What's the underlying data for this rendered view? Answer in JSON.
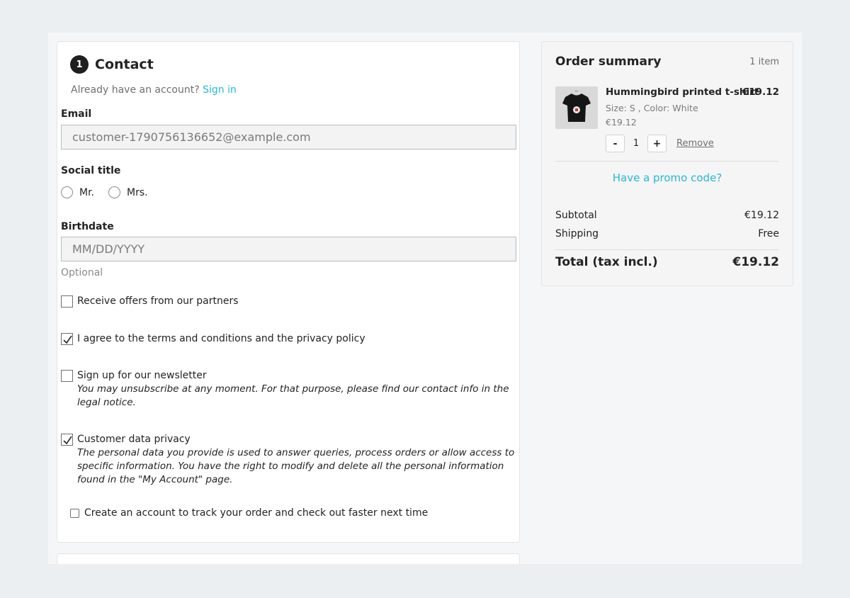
{
  "contact": {
    "step_number": "1",
    "title": "Contact",
    "already_account": "Already have an account?",
    "sign_in": "Sign in",
    "email_label": "Email",
    "email_value": "customer-1790756136652@example.com",
    "social_title_label": "Social title",
    "social_options": [
      "Mr.",
      "Mrs."
    ],
    "birthdate_label": "Birthdate",
    "birthdate_placeholder": "MM/DD/YYYY",
    "optional": "Optional",
    "checkboxes": [
      {
        "label": "Receive offers from our partners",
        "checked": false
      },
      {
        "label": "I agree to the terms and conditions and the privacy policy",
        "checked": true
      },
      {
        "label": "Sign up for our newsletter",
        "description": "You may unsubscribe at any moment. For that purpose, please find our contact info in the legal notice.",
        "checked": false
      },
      {
        "label": "Customer data privacy",
        "description": "The personal data you provide is used to answer queries, process orders or allow access to specific information. You have the right to modify and delete all the personal information found in the \"My Account\" page.",
        "checked": true
      }
    ],
    "create_account": "Create an account to track your order and check out faster next time"
  },
  "summary": {
    "title": "Order summary",
    "item_count": "1 item",
    "product": {
      "name": "Hummingbird printed t-shirt",
      "price": "€19.12",
      "attributes": "Size: S , Color: White",
      "unit_price": "€19.12",
      "quantity": "1",
      "decrease": "-",
      "increase": "+",
      "remove": "Remove"
    },
    "promo": "Have a promo code?",
    "subtotal_label": "Subtotal",
    "subtotal_value": "€19.12",
    "shipping_label": "Shipping",
    "shipping_value": "Free",
    "total_label": "Total (tax incl.)",
    "total_value": "€19.12"
  },
  "colors": {
    "accent": "#24b9d7",
    "text": "#232323",
    "muted": "#6f6f6f",
    "background": "#eceff2"
  }
}
